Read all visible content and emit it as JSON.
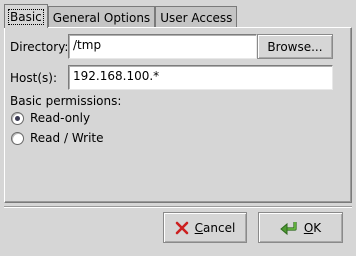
{
  "tabs": [
    {
      "label": "Basic",
      "active": true
    },
    {
      "label": "General Options",
      "active": false
    },
    {
      "label": "User Access",
      "active": false
    }
  ],
  "form": {
    "directory_label": "Directory:",
    "directory_value": "/tmp",
    "browse_label": "Browse...",
    "hosts_label": "Host(s):",
    "hosts_value": "192.168.100.*",
    "permissions_heading": "Basic permissions:",
    "permissions_options": [
      {
        "label": "Read-only",
        "checked": true
      },
      {
        "label": "Read / Write",
        "checked": false
      }
    ]
  },
  "buttons": {
    "cancel_first": "C",
    "cancel_rest": "ancel",
    "ok_first": "O",
    "ok_rest": "K",
    "cancel_icon": "red-x-icon",
    "ok_icon": "green-return-arrow-icon"
  },
  "colors": {
    "window_bg": "#d6d6d6",
    "cancel_icon_color": "#cc1f1f",
    "ok_icon_color": "#3f8a2a"
  }
}
